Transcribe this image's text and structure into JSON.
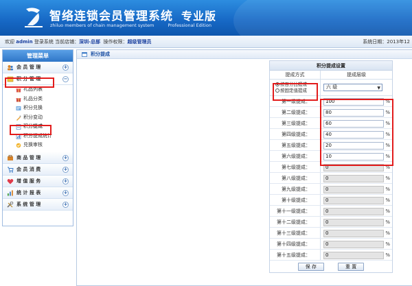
{
  "brand": {
    "title": "智络连锁会员管理系统",
    "edition": "专业版",
    "subtitle": "zhiluo members of chain management system",
    "edition_en": "Professional Edition"
  },
  "infobar": {
    "welcome": "欢迎",
    "user": "admin",
    "login_text": "登录系统",
    "store_label": "当前店铺：",
    "store": "深圳-总部",
    "perm_label": "操作权限：",
    "perm": "超级管理员",
    "date_label": "系统日期：2013年12"
  },
  "sidebar": {
    "title": "管理菜单",
    "groups": [
      {
        "label": "会 员 管 理",
        "icon": "members-icon",
        "toggle": "+"
      },
      {
        "label": "积 分 管 理",
        "icon": "points-icon",
        "toggle": "−",
        "items": [
          {
            "label": "礼品列表",
            "icon": "gift-icon"
          },
          {
            "label": "礼品分类",
            "icon": "gift-category-icon"
          },
          {
            "label": "积分兑换",
            "icon": "exchange-icon"
          },
          {
            "label": "积分变动",
            "icon": "change-icon"
          },
          {
            "label": "积分提成",
            "icon": "commission-icon"
          },
          {
            "label": "积分提成统计",
            "icon": "stats-icon"
          },
          {
            "label": "兑换审核",
            "icon": "audit-icon"
          }
        ]
      },
      {
        "label": "商 品 管 理",
        "icon": "goods-icon",
        "toggle": "+"
      },
      {
        "label": "会 员 消 费",
        "icon": "consume-icon",
        "toggle": "+"
      },
      {
        "label": "增 值 服 务",
        "icon": "heart-icon",
        "toggle": "+"
      },
      {
        "label": "统 计 报 表",
        "icon": "report-icon",
        "toggle": "+"
      },
      {
        "label": "系 统 管 理",
        "icon": "tools-icon",
        "toggle": "+"
      }
    ]
  },
  "breadcrumb": "积分提成",
  "table": {
    "title": "积分提成设置",
    "col_mode": "提成方式",
    "col_level": "提成层级",
    "mode_percent": "按百分比提成",
    "mode_fixed": "按固定值提成",
    "level_selected": "六 级",
    "unit": "%",
    "rows": [
      {
        "label": "第一级提成：",
        "value": "100",
        "enabled": true
      },
      {
        "label": "第二级提成：",
        "value": "80",
        "enabled": true
      },
      {
        "label": "第三级提成：",
        "value": "60",
        "enabled": true
      },
      {
        "label": "第四级提成：",
        "value": "40",
        "enabled": true
      },
      {
        "label": "第五级提成：",
        "value": "20",
        "enabled": true
      },
      {
        "label": "第六级提成：",
        "value": "10",
        "enabled": true
      },
      {
        "label": "第七级提成：",
        "value": "0",
        "enabled": false
      },
      {
        "label": "第八级提成：",
        "value": "0",
        "enabled": false
      },
      {
        "label": "第九级提成：",
        "value": "0",
        "enabled": false
      },
      {
        "label": "第十级提成：",
        "value": "0",
        "enabled": false
      },
      {
        "label": "第十一级提成：",
        "value": "0",
        "enabled": false
      },
      {
        "label": "第十二级提成：",
        "value": "0",
        "enabled": false
      },
      {
        "label": "第十三级提成：",
        "value": "0",
        "enabled": false
      },
      {
        "label": "第十四级提成：",
        "value": "0",
        "enabled": false
      },
      {
        "label": "第十五级提成：",
        "value": "0",
        "enabled": false
      }
    ],
    "save_label": "保 存",
    "reset_label": "重 置"
  },
  "colors": {
    "highlight": "#e21b1b",
    "banner": "#1667c4",
    "link": "#1a3f9e"
  }
}
